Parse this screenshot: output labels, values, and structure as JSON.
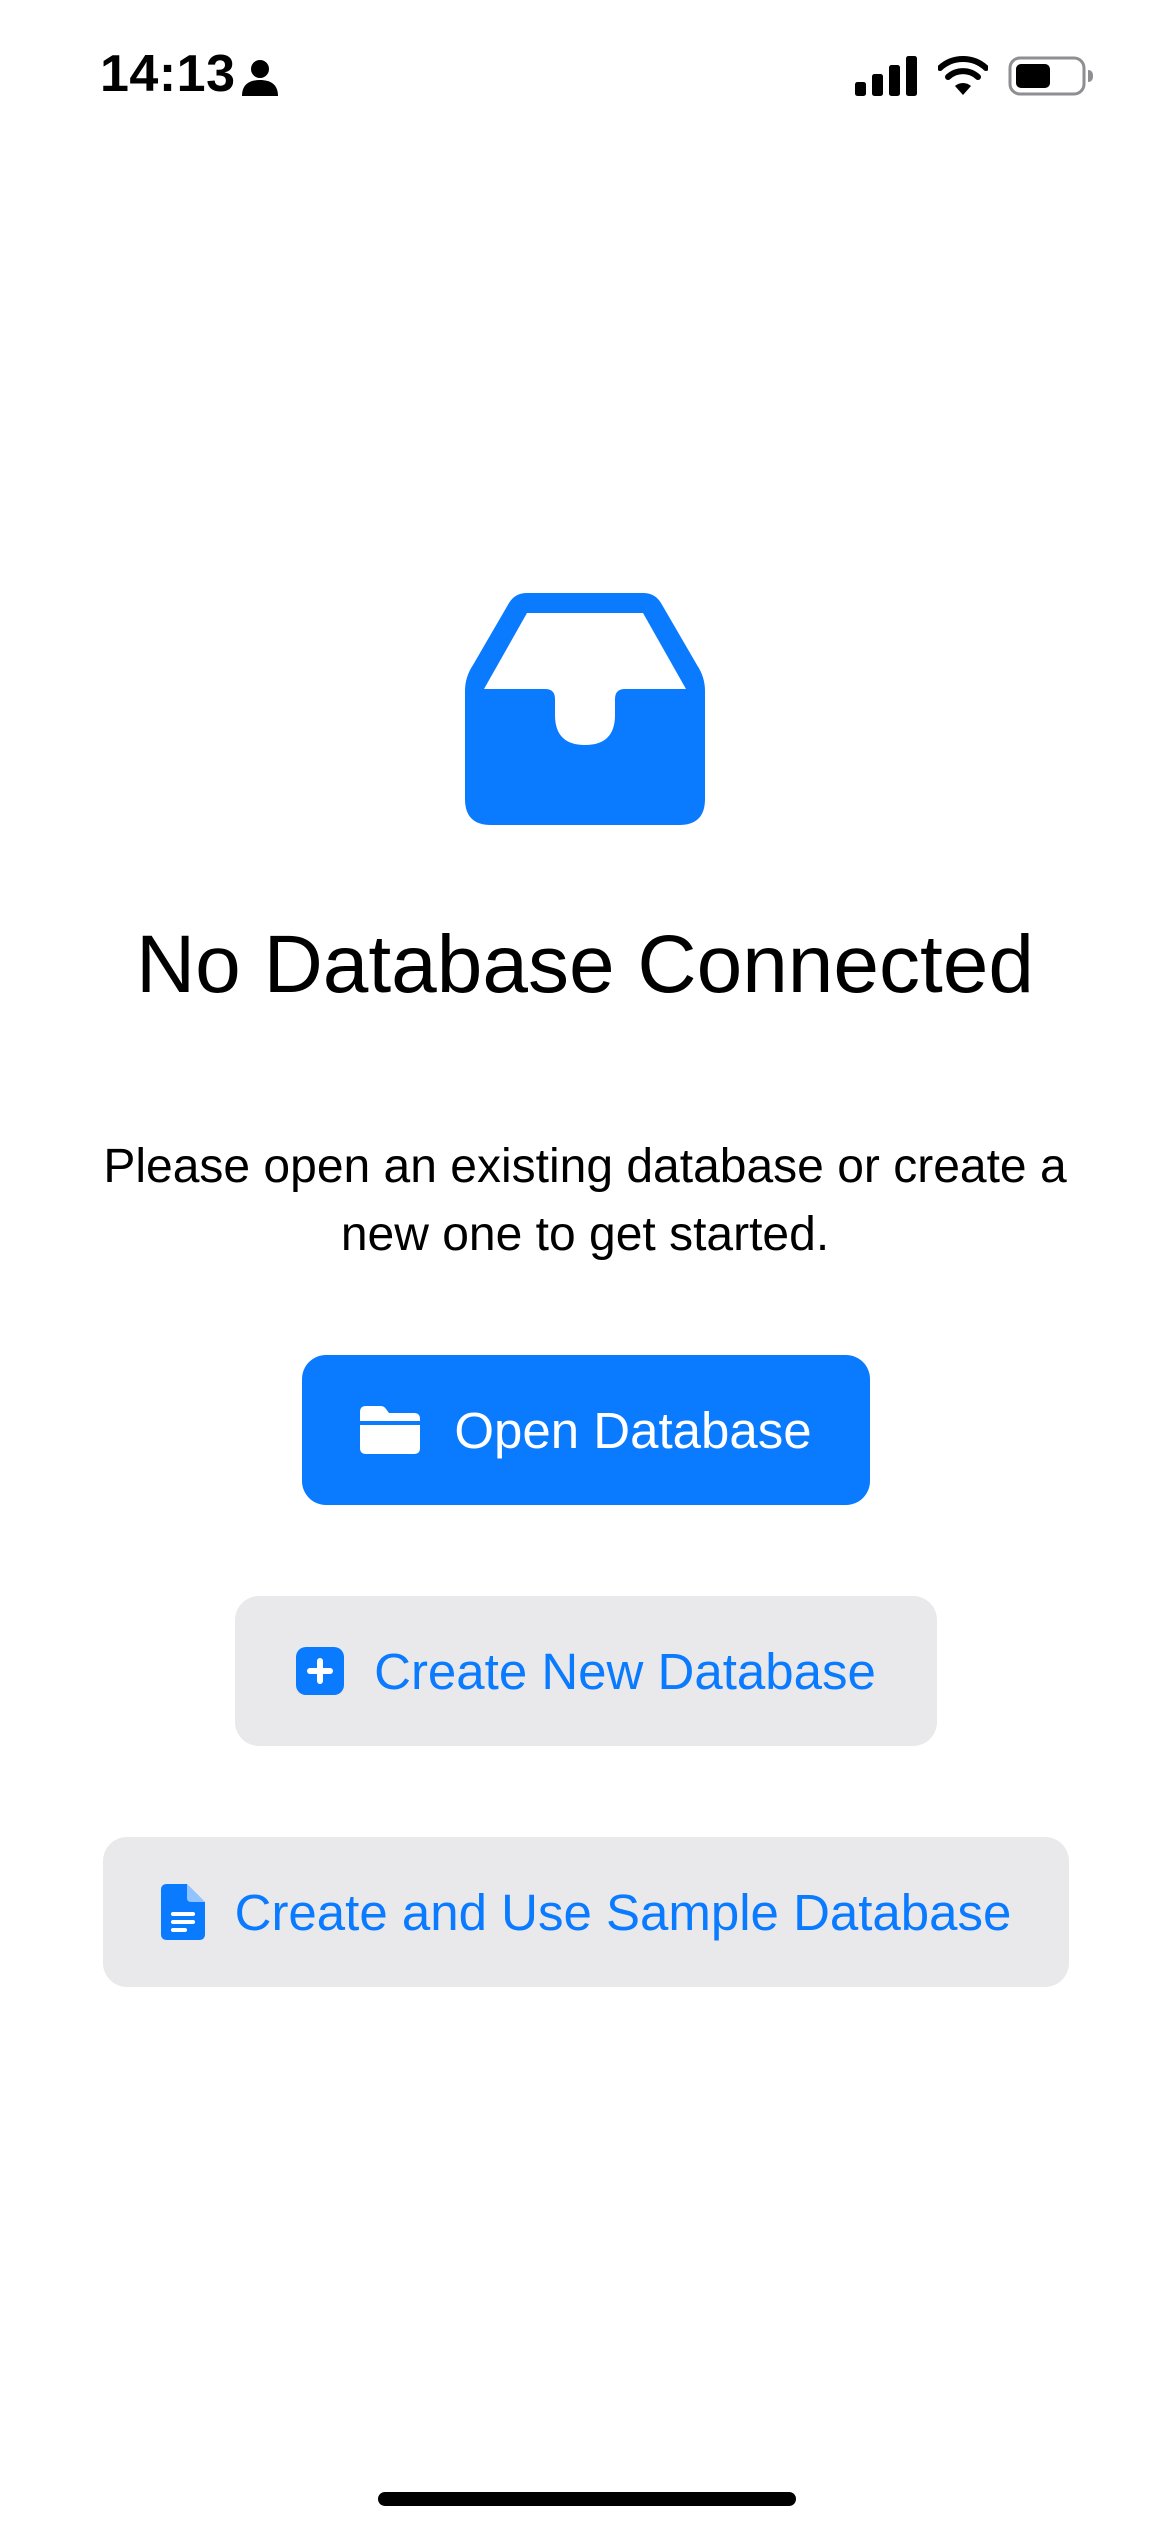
{
  "status_bar": {
    "time": "14:13",
    "icons": [
      "person-icon",
      "cellular-signal-icon",
      "wifi-icon",
      "battery-icon"
    ]
  },
  "empty_state": {
    "icon": "tray-icon",
    "title": "No Database Connected",
    "message": "Please open an existing database or create a new one to get started."
  },
  "actions": {
    "open": {
      "label": "Open Database",
      "icon": "folder-icon"
    },
    "create": {
      "label": "Create New Database",
      "icon": "plus-square-icon"
    },
    "sample": {
      "label": "Create and Use Sample Database",
      "icon": "document-icon"
    }
  },
  "colors": {
    "accent": "#0a7aff",
    "secondary_button_bg": "#e9e9eb",
    "background": "#ffffff",
    "text": "#000000"
  }
}
